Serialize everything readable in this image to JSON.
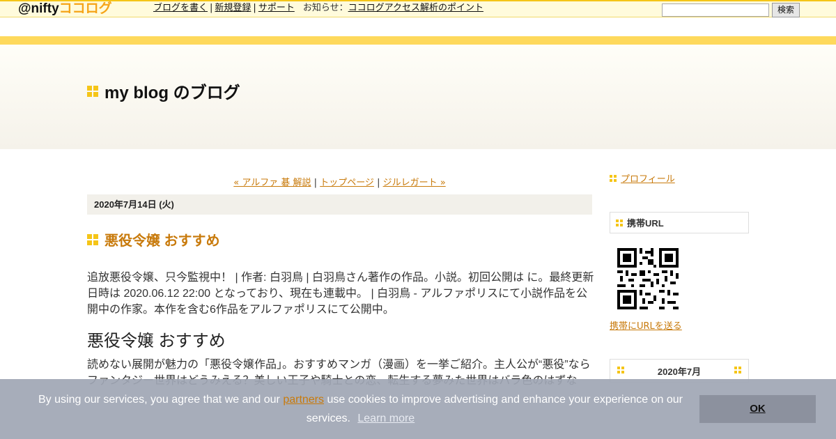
{
  "topbar": {
    "logo_prefix": "@nifty",
    "logo_main": "ココログ",
    "nav": [
      {
        "label": "ブログを書く"
      },
      {
        "label": "新規登録"
      },
      {
        "label": "サポート"
      }
    ],
    "notice_label": "お知らせ",
    "notice_colon": "：",
    "notice_link": "ココログアクセス解析のポイント",
    "search_value": "",
    "search_button": "検索"
  },
  "header": {
    "blog_title": "my blog のブログ"
  },
  "entry_nav": {
    "prev": "« アルファ 碁 解説",
    "sep": "|",
    "top": "トップページ",
    "next": "ジルレガート »"
  },
  "entry": {
    "date": "2020年7月14日 (火)",
    "title": "悪役令嬢 おすすめ",
    "body": "追放悪役令嬢、只今監視中！ | 作者: 白羽鳥 | 白羽鳥さん著作の作品。小説。初回公開は に。最終更新日時は 2020.06.12 22:00 となっており、現在も連載中。 | 白羽鳥 - アルファポリスにて小説作品を公開中の作家。本作を含む6作品をアルファポリスにて公開中。",
    "subheading": "悪役令嬢 おすすめ",
    "body2": "読めない展開が魅力の「悪役令嬢作品」。おすすめマンガ（漫画）を一挙ご紹介。主人公が“悪役”ならファンタジー世界はどうみえる？美しい王子や騎士との恋、転生する夢みた世界はバラ色のはずな"
  },
  "sidebar": {
    "profile_label": "プロフィール",
    "mobile_title": "携帯URL",
    "send_url_label": "携帯にURLを送る",
    "calendar_title": "2020年7月"
  },
  "cookie": {
    "text_before": "By using our services, you agree that we and our",
    "partners_label": "partners",
    "text_after": "use cookies to improve advertising and enhance your experience on our services.",
    "learn_more": "Learn more",
    "ok_label": "OK"
  },
  "colors": {
    "accent": "#f5c518",
    "link": "#c87a0b",
    "overlay": "#a0a6b4"
  }
}
